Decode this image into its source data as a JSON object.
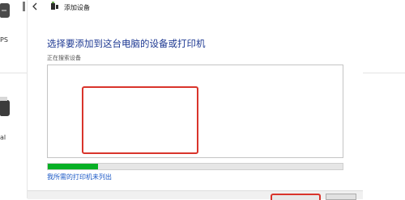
{
  "background_window": {
    "item_label_top": "PS",
    "item_label_bottom": "al"
  },
  "dialog": {
    "title": "添加设备",
    "heading": "选择要添加到这台电脑的设备或打印机",
    "status": "正在搜索设备",
    "progress_fraction": 0.17,
    "missing_printer_link": "我所需的打印机未列出",
    "icons": {
      "back": "back-arrow-icon",
      "title": "add-device-icon"
    },
    "colors": {
      "heading": "#1f3a93",
      "link": "#1a57c6",
      "progress": "#06b025",
      "highlight": "#d9342b"
    }
  }
}
